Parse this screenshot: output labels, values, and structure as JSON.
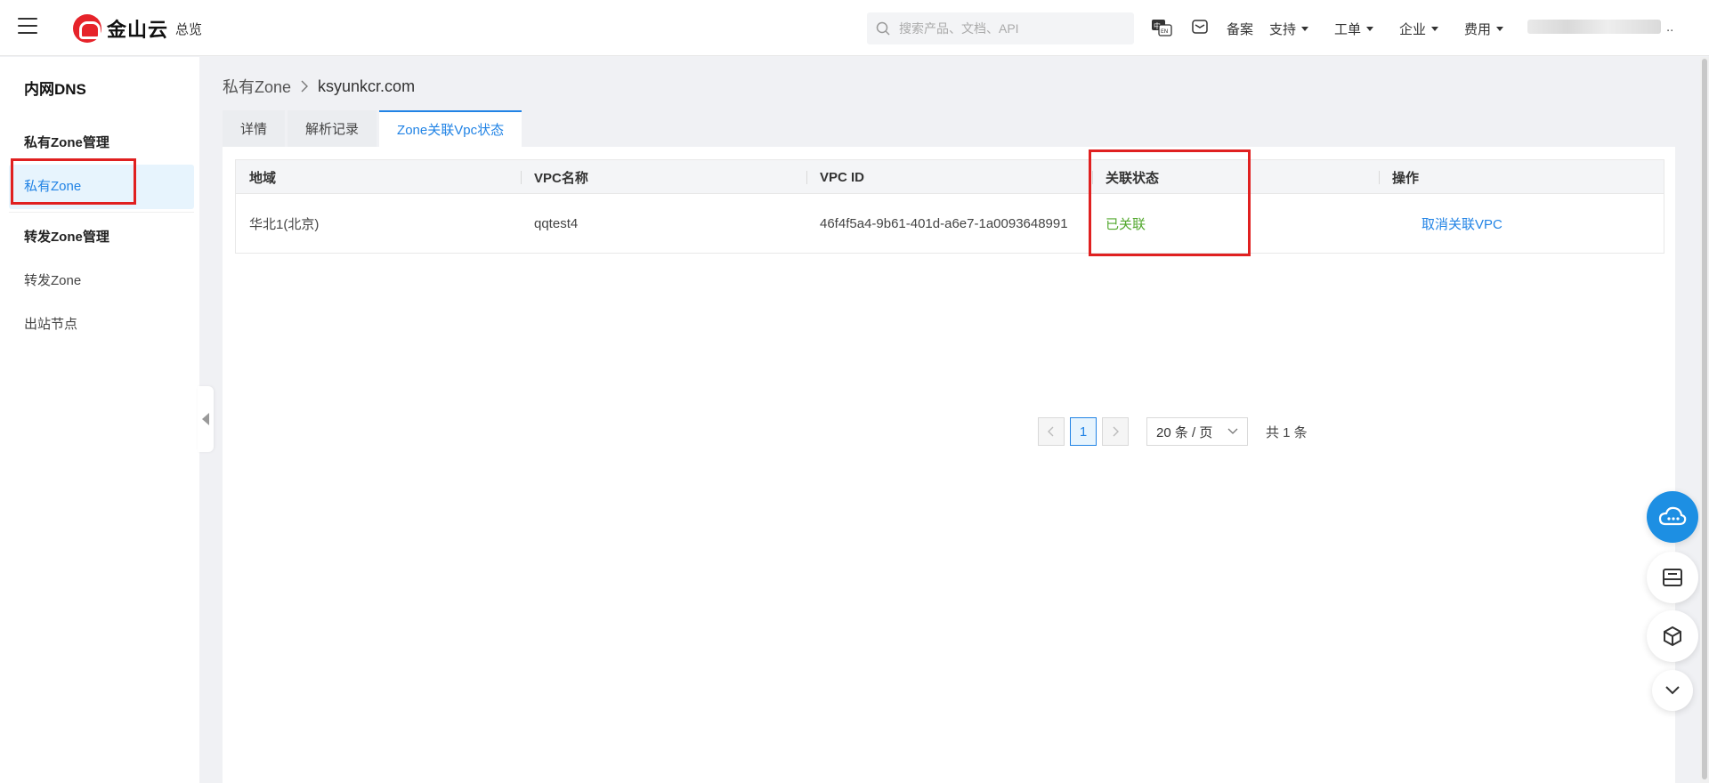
{
  "header": {
    "brand": "金山云",
    "overview_label": "总览",
    "search_placeholder": "搜索产品、文档、API",
    "nav": [
      {
        "label": "备案",
        "dropdown": false
      },
      {
        "label": "支持",
        "dropdown": true
      },
      {
        "label": "工单",
        "dropdown": true
      },
      {
        "label": "企业",
        "dropdown": true
      },
      {
        "label": "费用",
        "dropdown": true
      }
    ],
    "user_suffix": ".."
  },
  "sidebar": {
    "title": "内网DNS",
    "group1": "私有Zone管理",
    "item_active": "私有Zone",
    "group2": "转发Zone管理",
    "item2": "转发Zone",
    "item3": "出站节点"
  },
  "breadcrumb": {
    "parent": "私有Zone",
    "current": "ksyunkcr.com"
  },
  "tabs": [
    "详情",
    "解析记录",
    "Zone关联Vpc状态"
  ],
  "table": {
    "headers": [
      "地域",
      "VPC名称",
      "VPC ID",
      "关联状态",
      "操作"
    ],
    "rows": [
      {
        "region": "华北1(北京)",
        "vpc_name": "qqtest4",
        "vpc_id": "46f4f5a4-9b61-401d-a6e7-1a0093648991",
        "status": "已关联",
        "action": "取消关联VPC"
      }
    ]
  },
  "pagination": {
    "current_page": "1",
    "page_size": "20 条 / 页",
    "total": "共 1 条"
  },
  "colors": {
    "accent": "#2183e5",
    "status_ok": "#52a82d",
    "highlight": "#e02020",
    "brand_red": "#e6232a"
  }
}
